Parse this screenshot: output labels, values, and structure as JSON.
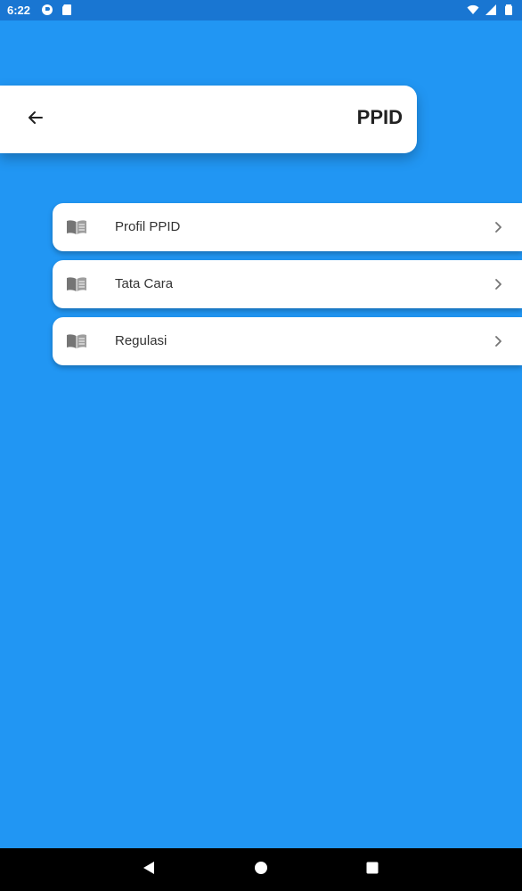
{
  "status_bar": {
    "time": "6:22",
    "left_icons": [
      "sync-icon",
      "sd-card-icon"
    ],
    "right_icons": [
      "wifi-icon",
      "signal-icon",
      "battery-icon"
    ]
  },
  "header": {
    "title": "PPID",
    "back_icon": "arrow-left-icon"
  },
  "menu": {
    "items": [
      {
        "label": "Profil PPID",
        "icon": "book-open-icon"
      },
      {
        "label": "Tata Cara",
        "icon": "book-open-icon"
      },
      {
        "label": "Regulasi",
        "icon": "book-open-icon"
      }
    ]
  },
  "nav_bar": {
    "buttons": [
      "back-triangle-icon",
      "home-circle-icon",
      "recents-square-icon"
    ]
  },
  "colors": {
    "background": "#2196f3",
    "status_bar": "#1976d2",
    "card": "#ffffff",
    "title_text": "#212121",
    "item_text": "#333333",
    "icon_gray": "#757575"
  }
}
